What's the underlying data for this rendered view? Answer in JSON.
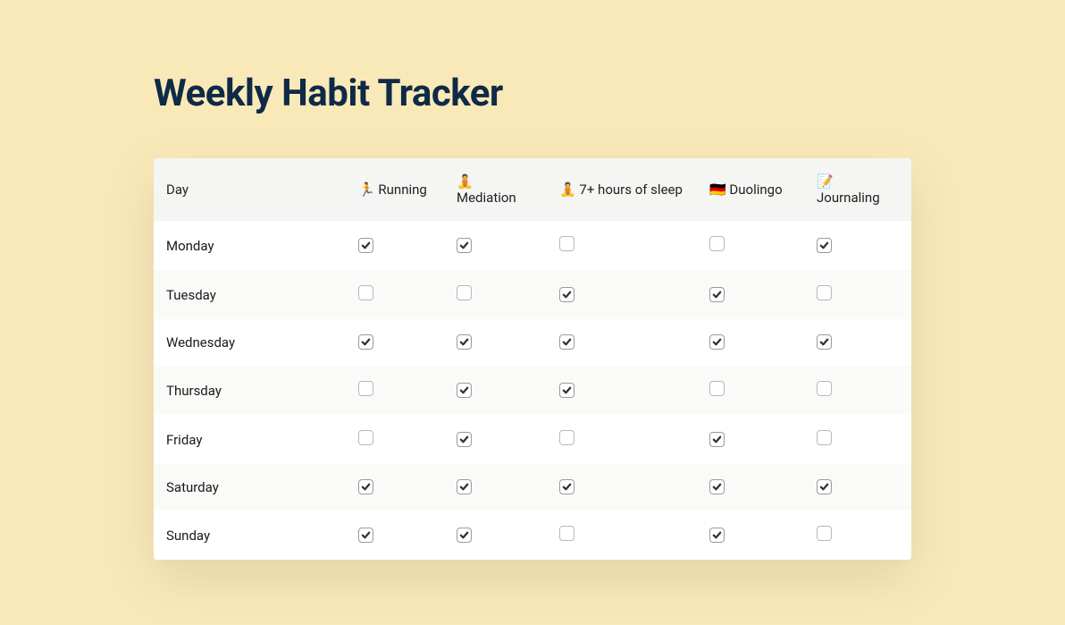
{
  "title": "Weekly Habit Tracker",
  "table": {
    "day_header": "Day",
    "habits": [
      "🏃 Running",
      "🧘 Mediation",
      "🧘 7+ hours of sleep",
      "🇩🇪 Duolingo",
      "📝 Journaling"
    ],
    "rows": [
      {
        "day": "Monday",
        "checks": [
          true,
          true,
          false,
          false,
          true
        ]
      },
      {
        "day": "Tuesday",
        "checks": [
          false,
          false,
          true,
          true,
          false
        ]
      },
      {
        "day": "Wednesday",
        "checks": [
          true,
          true,
          true,
          true,
          true
        ]
      },
      {
        "day": "Thursday",
        "checks": [
          false,
          true,
          true,
          false,
          false
        ]
      },
      {
        "day": "Friday",
        "checks": [
          false,
          true,
          false,
          true,
          false
        ]
      },
      {
        "day": "Saturday",
        "checks": [
          true,
          true,
          true,
          true,
          true
        ]
      },
      {
        "day": "Sunday",
        "checks": [
          true,
          true,
          false,
          true,
          false
        ]
      }
    ]
  }
}
